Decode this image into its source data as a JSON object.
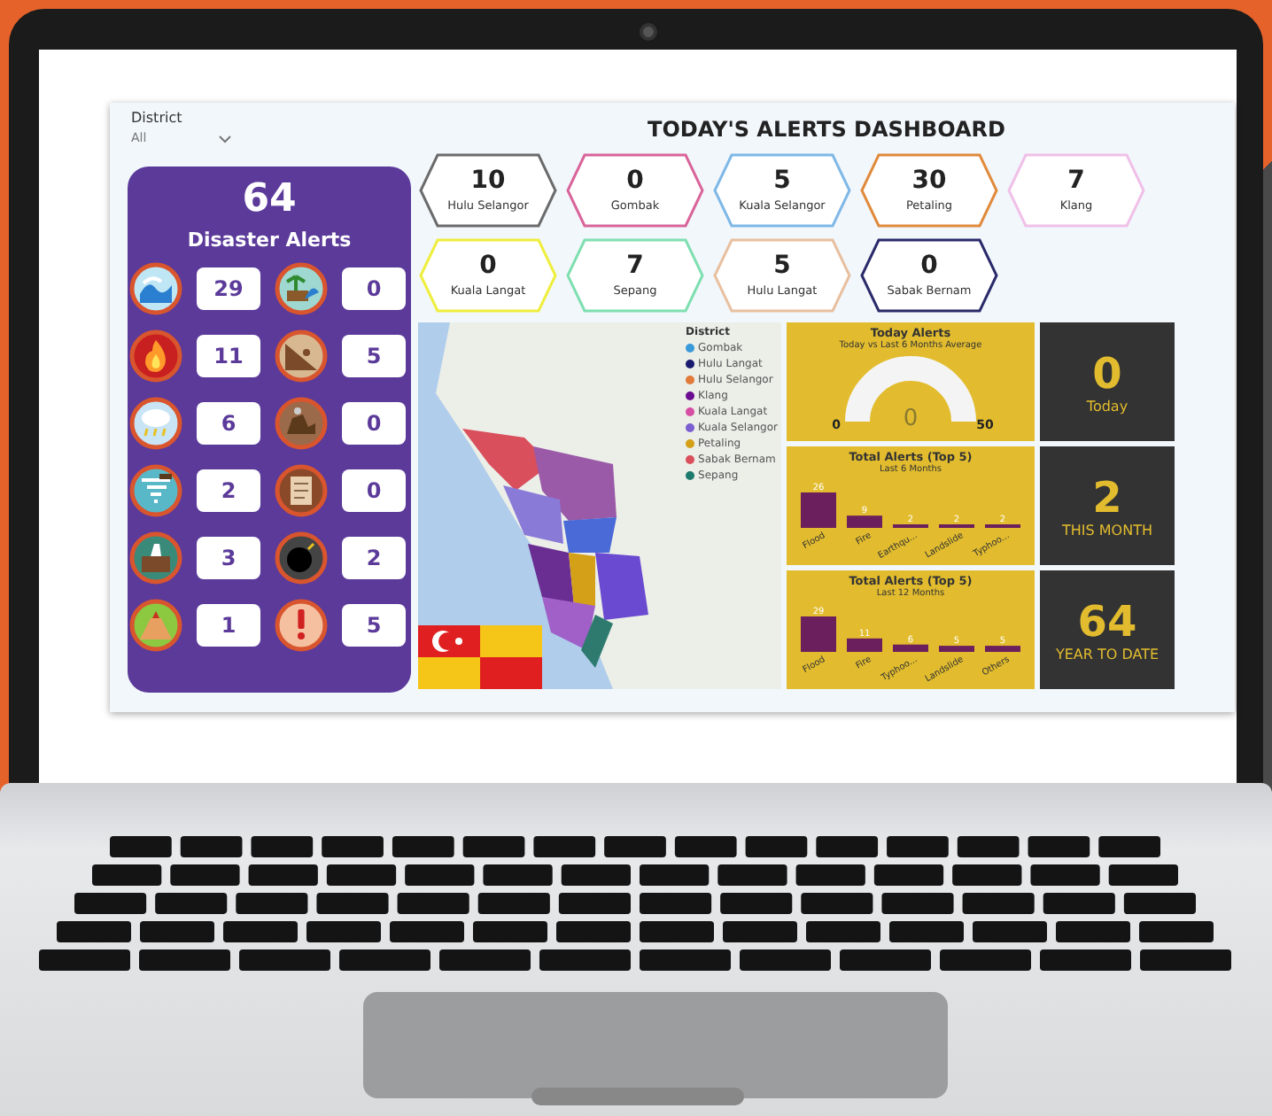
{
  "filter": {
    "label": "District",
    "value": "All"
  },
  "summary": {
    "total": "64",
    "title": "Disaster Alerts"
  },
  "alert_tiles": [
    {
      "count": "29"
    },
    {
      "count": "0"
    },
    {
      "count": "11"
    },
    {
      "count": "5"
    },
    {
      "count": "6"
    },
    {
      "count": "0"
    },
    {
      "count": "2"
    },
    {
      "count": "0"
    },
    {
      "count": "3"
    },
    {
      "count": "2"
    },
    {
      "count": "1"
    },
    {
      "count": "5"
    }
  ],
  "title": "TODAY'S ALERTS DASHBOARD",
  "districts": [
    {
      "count": "10",
      "name": "Hulu Selangor",
      "color": "#6b6b6b"
    },
    {
      "count": "0",
      "name": "Gombak",
      "color": "#d9649a"
    },
    {
      "count": "5",
      "name": "Kuala Selangor",
      "color": "#7fb8e6"
    },
    {
      "count": "30",
      "name": "Petaling",
      "color": "#e08a3c"
    },
    {
      "count": "7",
      "name": "Klang",
      "color": "#f0c0e8"
    },
    {
      "count": "0",
      "name": "Kuala Langat",
      "color": "#eeee3c"
    },
    {
      "count": "7",
      "name": "Sepang",
      "color": "#7fdfb0"
    },
    {
      "count": "5",
      "name": "Hulu Langat",
      "color": "#e8c0a0"
    },
    {
      "count": "0",
      "name": "Sabak Bernam",
      "color": "#2a2a6a"
    }
  ],
  "map": {
    "legend_title": "District",
    "legend": [
      {
        "name": "Gombak",
        "color": "#3a9ad9"
      },
      {
        "name": "Hulu Langat",
        "color": "#1a1a6e"
      },
      {
        "name": "Hulu Selangor",
        "color": "#e07b39"
      },
      {
        "name": "Klang",
        "color": "#6a0d91"
      },
      {
        "name": "Kuala Langat",
        "color": "#d64fa5"
      },
      {
        "name": "Kuala Selangor",
        "color": "#7b5fd0"
      },
      {
        "name": "Petaling",
        "color": "#d4a017"
      },
      {
        "name": "Sabak Bernam",
        "color": "#d94f5c"
      },
      {
        "name": "Sepang",
        "color": "#1f7a6e"
      }
    ]
  },
  "gauge": {
    "title": "Today Alerts",
    "subtitle": "Today vs Last 6 Months Average",
    "min": "0",
    "max": "50",
    "value": "0"
  },
  "charts": [
    {
      "title": "Total Alerts (Top 5)",
      "subtitle": "Last 6 Months",
      "chart_data": {
        "type": "bar",
        "categories": [
          "Flood",
          "Fire",
          "Earthqu...",
          "Landslide",
          "Typhoo..."
        ],
        "values": [
          26,
          9,
          2,
          2,
          2
        ],
        "data_labels": true
      }
    },
    {
      "title": "Total Alerts (Top 5)",
      "subtitle": "Last 12 Months",
      "chart_data": {
        "type": "bar",
        "categories": [
          "Flood",
          "Fire",
          "Typhoo...",
          "Landslide",
          "Others"
        ],
        "values": [
          29,
          11,
          6,
          5,
          5
        ],
        "data_labels": true
      }
    }
  ],
  "kpis": [
    {
      "value": "0",
      "label": "Today"
    },
    {
      "value": "2",
      "label": "THIS MONTH"
    },
    {
      "value": "64",
      "label": "YEAR TO DATE"
    }
  ]
}
